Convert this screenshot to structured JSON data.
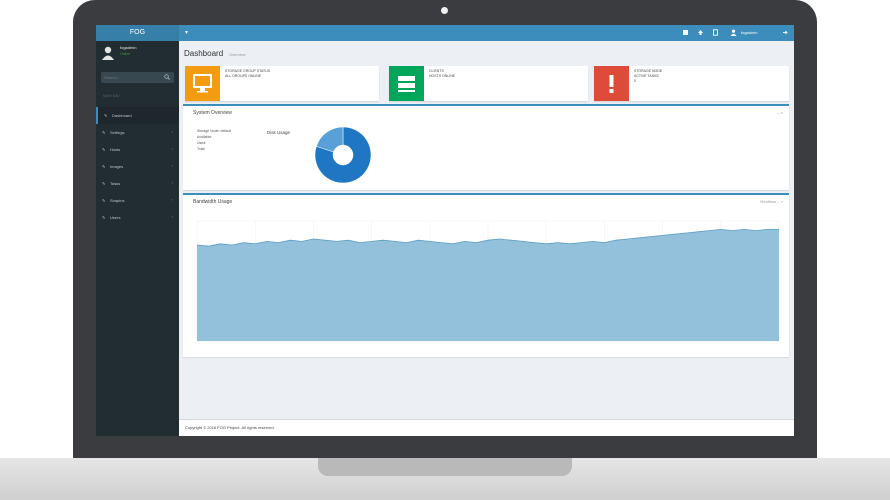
{
  "app": {
    "logo": "FOG"
  },
  "user": {
    "name": "fogadmin",
    "status": "Online"
  },
  "search": {
    "placeholder": "Search...",
    "value": ""
  },
  "sidebar": {
    "header": "MAIN NAV",
    "items": [
      {
        "label": "Dashboard",
        "active": true
      },
      {
        "label": "Settings"
      },
      {
        "label": "Hosts"
      },
      {
        "label": "Images"
      },
      {
        "label": "Tasks"
      },
      {
        "label": "Snapins"
      },
      {
        "label": "Users"
      }
    ]
  },
  "topbar": {
    "user": "fogadmin"
  },
  "page": {
    "title": "Dashboard",
    "subtitle": "Overview"
  },
  "infoboxes": [
    {
      "line1": "STORAGE GROUP STATUS",
      "line2": "ALL GROUPS ONLINE",
      "color": "#f39c12"
    },
    {
      "line1": "CLIENTS",
      "line2": "HOSTS ONLINE",
      "color": "#00a65a"
    },
    {
      "line1": "STORAGE NODE",
      "line2": "ACTIVE TASKS",
      "line3": "0",
      "color": "#dd4b39"
    }
  ],
  "system_overview": {
    "title": "System Overview",
    "stats": [
      "Storage Node: default",
      "Available: ",
      "Used: ",
      "Total: "
    ],
    "legend": "Disk Usage"
  },
  "bandwidth": {
    "title": "Bandwidth Usage",
    "tools_label": "Realtime"
  },
  "chart_data": [
    {
      "type": "pie",
      "title": "",
      "labels": [
        "Free",
        "Used"
      ],
      "values": [
        80,
        20
      ],
      "colors": [
        "#1f77c4",
        "#5aa0d8"
      ]
    },
    {
      "type": "area",
      "title": "",
      "ylim": [
        0,
        100
      ],
      "x": [
        0,
        1,
        2,
        3,
        4,
        5,
        6,
        7,
        8,
        9,
        10,
        11,
        12,
        13,
        14,
        15,
        16,
        17,
        18,
        19,
        20,
        21,
        22,
        23,
        24,
        25,
        26,
        27,
        28,
        29,
        30,
        31,
        32,
        33,
        34,
        35,
        36,
        37,
        38,
        39,
        40,
        41,
        42,
        43,
        44,
        45,
        46,
        47,
        48,
        49,
        50
      ],
      "values": [
        80,
        79,
        81,
        80,
        82,
        81,
        83,
        82,
        84,
        83,
        85,
        84,
        83,
        84,
        82,
        83,
        84,
        83,
        82,
        84,
        83,
        82,
        81,
        83,
        82,
        84,
        85,
        84,
        83,
        82,
        81,
        82,
        81,
        82,
        83,
        82,
        84,
        85,
        86,
        87,
        88,
        89,
        90,
        91,
        92,
        93,
        92,
        93,
        92,
        93,
        93
      ],
      "color": "#93c0db"
    }
  ],
  "footer": {
    "text": "Copyright © 2016 FOG Project. All rights reserved."
  }
}
